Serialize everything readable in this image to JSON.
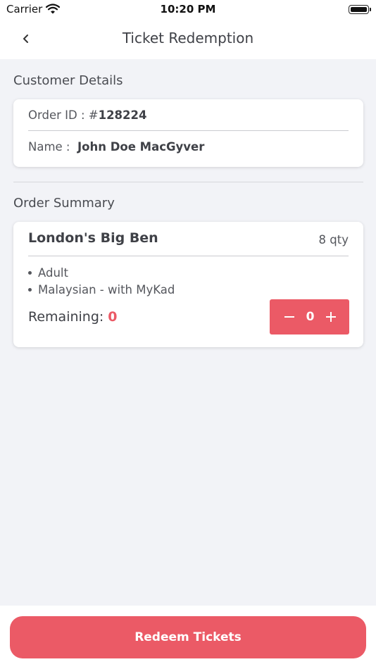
{
  "status_bar": {
    "carrier": "Carrier",
    "time": "10:20 PM"
  },
  "nav": {
    "title": "Ticket Redemption"
  },
  "customer": {
    "section_title": "Customer Details",
    "order_label": "Order ID : #",
    "order_id": "128224",
    "name_label": "Name :",
    "name": "John Doe MacGyver"
  },
  "order": {
    "section_title": "Order Summary",
    "item": {
      "title": "London's Big Ben",
      "qty": "8 qty",
      "details": [
        "Adult",
        "Malaysian - with MyKad"
      ],
      "remaining_label": "Remaining:",
      "remaining": "0",
      "stepper_value": "0"
    }
  },
  "footer": {
    "redeem_label": "Redeem Tickets"
  },
  "colors": {
    "accent": "#eb5a66",
    "background": "#f2f3f7"
  }
}
